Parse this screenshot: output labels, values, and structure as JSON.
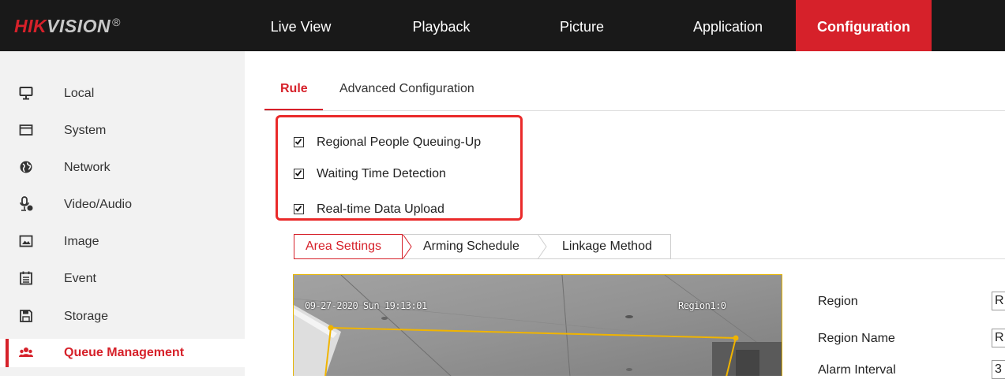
{
  "brand": {
    "name_red": "HIK",
    "name_grey": "VISION",
    "reg_mark": "®"
  },
  "nav": {
    "items": [
      {
        "label": "Live View",
        "active": false
      },
      {
        "label": "Playback",
        "active": false
      },
      {
        "label": "Picture",
        "active": false
      },
      {
        "label": "Application",
        "active": false
      },
      {
        "label": "Configuration",
        "active": true
      }
    ]
  },
  "sidebar": {
    "items": [
      {
        "label": "Local",
        "icon": "monitor-icon"
      },
      {
        "label": "System",
        "icon": "window-icon"
      },
      {
        "label": "Network",
        "icon": "globe-icon"
      },
      {
        "label": "Video/Audio",
        "icon": "microphone-icon"
      },
      {
        "label": "Image",
        "icon": "image-icon"
      },
      {
        "label": "Event",
        "icon": "calendar-icon"
      },
      {
        "label": "Storage",
        "icon": "floppy-icon"
      },
      {
        "label": "Queue Management",
        "icon": "people-icon",
        "active": true
      }
    ]
  },
  "tabs": {
    "rule": "Rule",
    "advanced": "Advanced Configuration"
  },
  "options": [
    {
      "label": "Regional People Queuing-Up",
      "checked": true
    },
    {
      "label": "Waiting Time Detection",
      "checked": true
    },
    {
      "label": "Real-time Data Upload",
      "checked": true
    }
  ],
  "steps": {
    "area": "Area Settings",
    "arming": "Arming Schedule",
    "linkage": "Linkage Method"
  },
  "video": {
    "timestamp": "09-27-2020 Sun 19:13:01",
    "region_overlay": "Region1:0"
  },
  "form": {
    "region_label": "Region",
    "region_value": "R",
    "region_name_label": "Region Name",
    "region_name_value": "R",
    "alarm_interval_label": "Alarm Interval",
    "alarm_interval_value": "3"
  },
  "colors": {
    "accent": "#d6212a",
    "topbar": "#191919",
    "sidebar": "#f2f2f2",
    "highlight": "#ea2a2a",
    "region_line": "#f0b400"
  }
}
